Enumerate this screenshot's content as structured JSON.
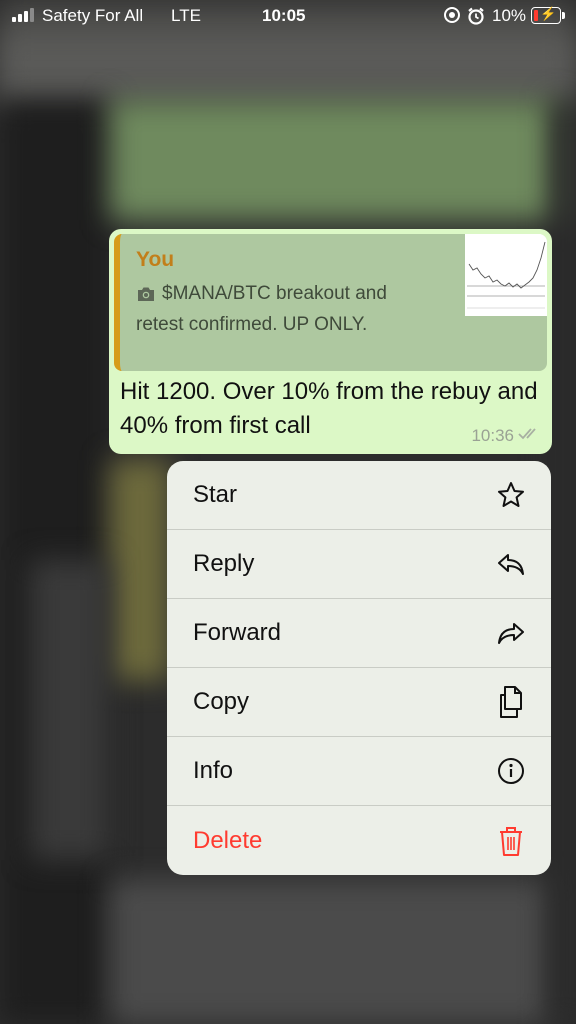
{
  "status_bar": {
    "carrier": "Safety For All",
    "network": "LTE",
    "time": "10:05",
    "battery_percent": "10%",
    "battery_level": 0.1,
    "icons": [
      "signal-icon",
      "screen-record-icon",
      "alarm-icon",
      "battery-charging-icon"
    ]
  },
  "message": {
    "quoted": {
      "author": "You",
      "text": "$MANA/BTC breakout and retest confirmed. UP ONLY.",
      "media_icon": "camera-icon",
      "accent_color": "#d69c1a"
    },
    "body": "Hit 1200. Over 10% from the rebuy and 40% from first call",
    "time": "10:36",
    "status_icon": "double-check-icon",
    "bubble_color": "#dcf8c6"
  },
  "context_menu": {
    "items": [
      {
        "label": "Star",
        "icon": "star-icon"
      },
      {
        "label": "Reply",
        "icon": "reply-icon"
      },
      {
        "label": "Forward",
        "icon": "forward-icon"
      },
      {
        "label": "Copy",
        "icon": "copy-icon"
      },
      {
        "label": "Info",
        "icon": "info-icon"
      },
      {
        "label": "Delete",
        "icon": "trash-icon",
        "color": "#ff3b30"
      }
    ]
  }
}
